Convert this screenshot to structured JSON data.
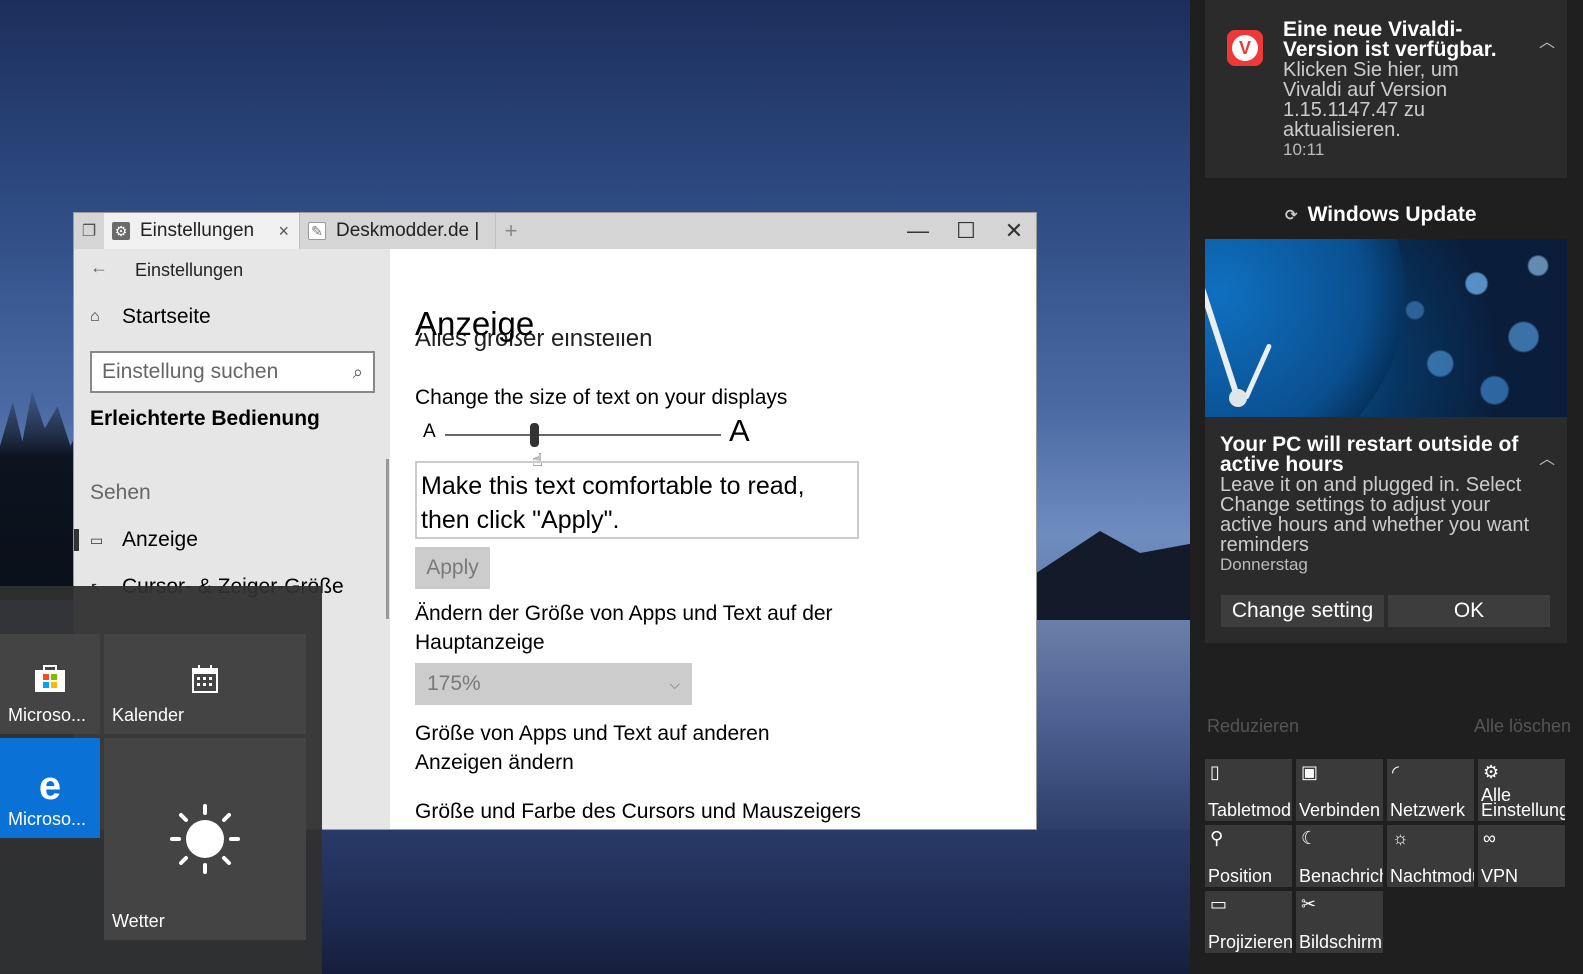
{
  "browser": {
    "tabs": [
      {
        "label": "Einstellungen",
        "icon": "gear-icon"
      },
      {
        "label": "Deskmodder.de |",
        "icon": "page-icon"
      }
    ],
    "new_tab_label": "+",
    "close_tab_glyph": "×"
  },
  "settings": {
    "header_title": "Einstellungen",
    "home_label": "Startseite",
    "search": {
      "value": "Einstellung suchen"
    },
    "category": "Erleichterte Bedienung",
    "group": "Sehen",
    "items": [
      {
        "label": "Anzeige",
        "icon": "monitor-icon"
      },
      {
        "label": "Cursor- & Zeiger-Größe",
        "icon": "cursor-icon"
      }
    ],
    "page_title": "Anzeige",
    "partial_heading": "Alles größer einstellen",
    "text_size_label": "Change the size of text on your displays",
    "slider": {
      "small_glyph": "A",
      "large_glyph": "A",
      "value_fraction": 0.33
    },
    "sample_text": "Make this text comfortable to read, then click \"Apply\".",
    "apply_label": "Apply",
    "scale_label": "Ändern der Größe von Apps und Text auf der Hauptanzeige",
    "scale_value": "175%",
    "other_displays_label": "Größe von Apps und Text auf anderen Anzeigen ändern",
    "cursor_label": "Größe und Farbe des Cursors und Mauszeigers"
  },
  "start_tiles": [
    {
      "label": "Microso...",
      "icon": "store-icon"
    },
    {
      "label": "Kalender",
      "icon": "calendar-icon"
    },
    {
      "label": "Microso...",
      "icon": "edge-icon"
    },
    {
      "label": "Wetter",
      "icon": "sun-icon"
    }
  ],
  "action_center": {
    "vivaldi": {
      "title": "Eine neue Vivaldi-Version ist verfügbar.",
      "body": "Klicken Sie hier, um Vivaldi auf Version 1.15.1147.47 zu aktualisieren.",
      "time": "10:11"
    },
    "windows_update": {
      "app": "Windows Update",
      "title": "Your PC will restart outside of active hours",
      "body": "Leave it on and plugged in. Select Change settings to adjust your active hours and whether you want reminders",
      "day": "Donnerstag",
      "buttons": [
        "Change setting",
        "OK"
      ]
    },
    "collapse_label": "Reduzieren",
    "clear_all_label": "Alle löschen",
    "quick_actions": [
      {
        "label": "Tabletmodus",
        "icon": "tablet-icon"
      },
      {
        "label": "Verbinden",
        "icon": "connect-icon"
      },
      {
        "label": "Netzwerk",
        "icon": "network-icon"
      },
      {
        "label": "Alle Einstellungen",
        "icon": "settings-icon"
      },
      {
        "label": "Position",
        "icon": "location-icon"
      },
      {
        "label": "Benachrichti-",
        "icon": "moon-icon"
      },
      {
        "label": "Nachtmodus",
        "icon": "nightlight-icon"
      },
      {
        "label": "VPN",
        "icon": "vpn-icon"
      },
      {
        "label": "Projizieren",
        "icon": "project-icon"
      },
      {
        "label": "Bildschirmnausschn",
        "icon": "snip-icon"
      }
    ]
  },
  "colors": {
    "accent": "#0a72d6",
    "vivaldi_red": "#ef3939",
    "action_center_bg": "#1f1f1f"
  }
}
